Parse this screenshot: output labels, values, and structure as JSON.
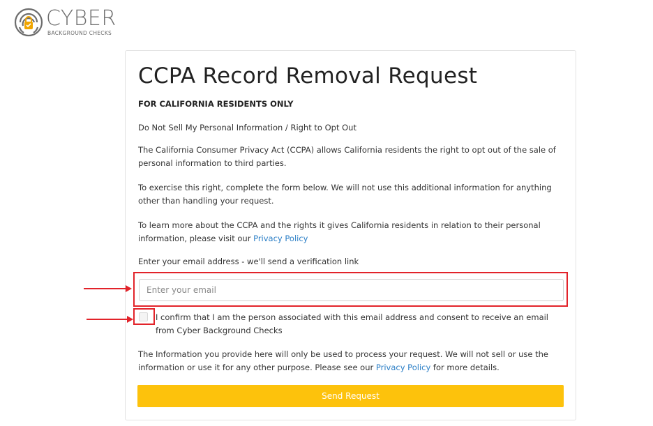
{
  "brand": {
    "name": "CYBER",
    "subtitle": "BACKGROUND CHECKS"
  },
  "form": {
    "title": "CCPA Record Removal Request",
    "subtitle": "FOR CALIFORNIA RESIDENTS ONLY",
    "intro": "Do Not Sell My Personal Information / Right to Opt Out",
    "para1": "The California Consumer Privacy Act (CCPA) allows California residents the right to opt out of the sale of personal information to third parties.",
    "para2": "To exercise this right, complete the form below. We will not use this additional information for anything other than handling your request.",
    "para3_prefix": "To learn more about the CCPA and the rights it gives California residents in relation to their personal information, please visit our ",
    "privacy_link": "Privacy Policy",
    "email_label": "Enter your email address - we'll send a verification link",
    "email_placeholder": "Enter your email",
    "email_value": "",
    "confirm_text": "I confirm that I am the person associated with this email address and consent to receive an email from Cyber Background Checks",
    "footer_prefix": "The Information you provide here will only be used to process your request. We will not sell or use the information or use it for any other purpose. Please see our ",
    "footer_link": "Privacy Policy",
    "footer_suffix": " for more details.",
    "submit_label": "Send Request"
  },
  "colors": {
    "accent": "#fdc20c",
    "link": "#2a7ec6",
    "highlight": "#e2232a"
  }
}
